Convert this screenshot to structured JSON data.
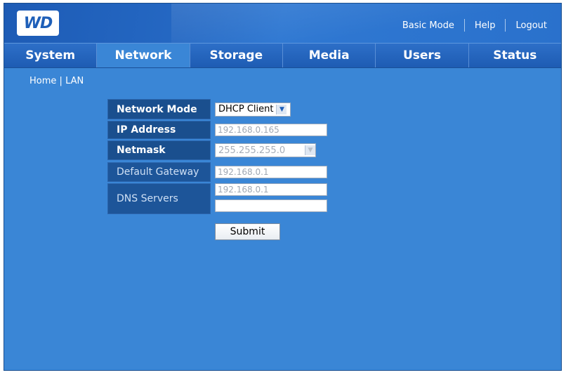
{
  "brand": {
    "logo_text": "WD"
  },
  "toplinks": {
    "basic_mode": "Basic Mode",
    "help": "Help",
    "logout": "Logout"
  },
  "tabs": [
    {
      "label": "System"
    },
    {
      "label": "Network",
      "active": true
    },
    {
      "label": "Storage"
    },
    {
      "label": "Media"
    },
    {
      "label": "Users"
    },
    {
      "label": "Status"
    }
  ],
  "breadcrumb": {
    "home": "Home",
    "separator": "|",
    "current": "LAN"
  },
  "form": {
    "network_mode": {
      "label": "Network Mode",
      "value": "DHCP Client"
    },
    "ip_address": {
      "label": "IP Address",
      "value": "192.168.0.165"
    },
    "netmask": {
      "label": "Netmask",
      "value": "255.255.255.0"
    },
    "default_gateway": {
      "label": "Default Gateway",
      "value": "192.168.0.1"
    },
    "dns_servers": {
      "label": "DNS Servers",
      "primary": "192.168.0.1",
      "secondary": ""
    },
    "submit_label": "Submit"
  },
  "colors": {
    "background": "#3a86d6",
    "label_bg": "#1a4f8e",
    "header": "#1e5fb8"
  }
}
